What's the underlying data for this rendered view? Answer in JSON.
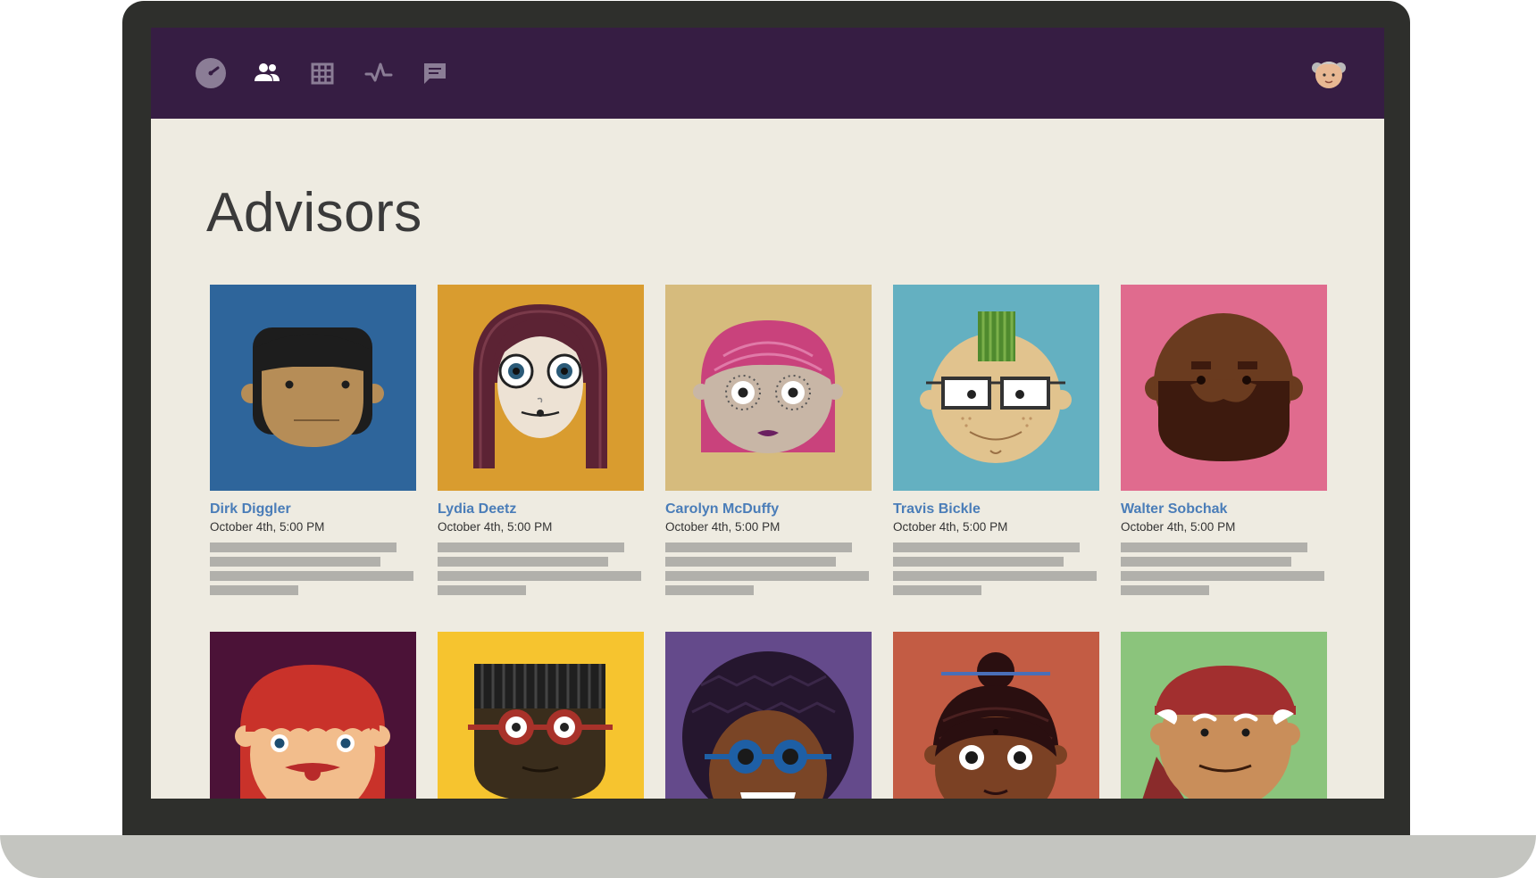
{
  "nav": {
    "icons": [
      "dashboard-icon",
      "people-icon",
      "grid-icon",
      "activity-icon",
      "chat-icon"
    ],
    "active": "people-icon",
    "user_avatar": "user-avatar"
  },
  "page": {
    "title": "Advisors"
  },
  "advisors": [
    {
      "name": "Dirk Diggler",
      "datetime": "October 4th, 5:00 PM",
      "bg": "#2e659b"
    },
    {
      "name": "Lydia Deetz",
      "datetime": "October 4th, 5:00 PM",
      "bg": "#d99c2f"
    },
    {
      "name": "Carolyn McDuffy",
      "datetime": "October 4th, 5:00 PM",
      "bg": "#d6bb7d"
    },
    {
      "name": "Travis Bickle",
      "datetime": "October 4th, 5:00 PM",
      "bg": "#64b0c1"
    },
    {
      "name": "Walter Sobchak",
      "datetime": "October 4th, 5:00 PM",
      "bg": "#e06b8e"
    }
  ],
  "advisors_row2_bgs": [
    "#4b1237",
    "#f6c42f",
    "#644a8b",
    "#c35c44",
    "#8bc47c"
  ],
  "colors": {
    "header": "#361d43",
    "page_bg": "#eeebe1",
    "link": "#4a7db8",
    "placeholder_bar": "#b1b0ab"
  }
}
